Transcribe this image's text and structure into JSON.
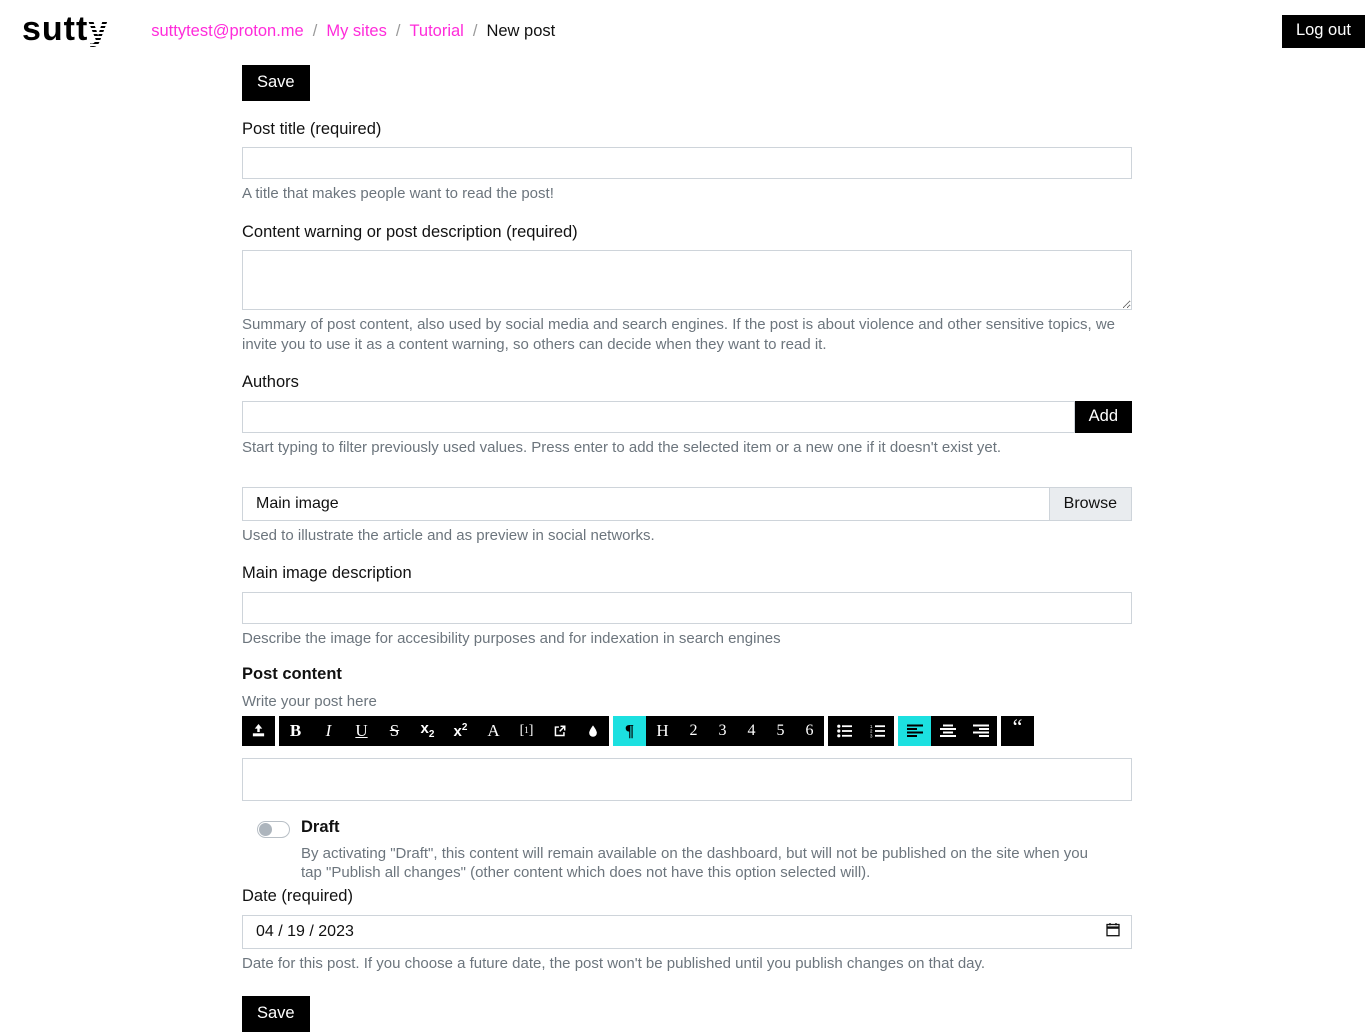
{
  "brand": {
    "name": "sutty",
    "accent": "#1ce0e0",
    "link_color": "#ff2bda"
  },
  "header": {
    "breadcrumb": [
      {
        "label": "suttytest@proton.me",
        "type": "link"
      },
      {
        "label": "/",
        "type": "sep"
      },
      {
        "label": "My sites",
        "type": "link"
      },
      {
        "label": "/",
        "type": "sep"
      },
      {
        "label": "Tutorial",
        "type": "link"
      },
      {
        "label": "/",
        "type": "sep"
      },
      {
        "label": "New post",
        "type": "current"
      }
    ],
    "logout_label": "Log out"
  },
  "form": {
    "save_top_label": "Save",
    "save_bottom_label": "Save",
    "post_title": {
      "label": "Post title (required)",
      "value": "",
      "help": "A title that makes people want to read the post!"
    },
    "content_warning": {
      "label": "Content warning or post description (required)",
      "value": "",
      "help": "Summary of post content, also used by social media and search engines. If the post is about violence and other sensitive topics, we invite you to use it as a content warning, so others can decide when they want to read it."
    },
    "authors": {
      "label": "Authors",
      "value": "",
      "add_label": "Add",
      "help": "Start typing to filter previously used values. Press enter to add the selected item or a new one if it doesn't exist yet."
    },
    "main_image": {
      "filename_label": "Main image",
      "browse_label": "Browse",
      "help": "Used to illustrate the article and as preview in social networks."
    },
    "main_image_description": {
      "label": "Main image description",
      "value": "",
      "help": "Describe the image for accesibility purposes and for indexation in search engines"
    },
    "post_content": {
      "label": "Post content",
      "hint": "Write your post here",
      "value": ""
    },
    "draft": {
      "title": "Draft",
      "state": "off",
      "help": "By activating \"Draft\", this content will remain available on the dashboard, but will not be published on the site when you tap \"Publish all changes\" (other content which does not have this option selected will)."
    },
    "date": {
      "label": "Date (required)",
      "value": "04 / 19 / 2023",
      "help": "Date for this post. If you choose a future date, the post won't be published until you publish changes on that day."
    }
  },
  "toolbar": {
    "groups": [
      {
        "name": "upload",
        "buttons": [
          {
            "icon": "upload-icon",
            "label": "",
            "active": false
          }
        ]
      },
      {
        "name": "inline-format",
        "buttons": [
          {
            "icon": "bold-icon",
            "label": "B",
            "active": false
          },
          {
            "icon": "italic-icon",
            "label": "I",
            "active": false
          },
          {
            "icon": "underline-icon",
            "label": "U",
            "active": false
          },
          {
            "icon": "strikethrough-icon",
            "label": "S",
            "active": false
          },
          {
            "icon": "subscript-icon",
            "label": "x2",
            "active": false
          },
          {
            "icon": "superscript-icon",
            "label": "x2",
            "active": false
          },
          {
            "icon": "font-icon",
            "label": "A",
            "active": false
          },
          {
            "icon": "footnote-icon",
            "label": "[1]",
            "active": false
          },
          {
            "icon": "external-link-icon",
            "label": "",
            "active": false
          },
          {
            "icon": "ink-drop-icon",
            "label": "",
            "active": false
          }
        ]
      },
      {
        "name": "block-format",
        "buttons": [
          {
            "icon": "paragraph-icon",
            "label": "¶",
            "active": true
          },
          {
            "icon": "heading-icon",
            "label": "H",
            "active": false
          },
          {
            "icon": "heading-2-icon",
            "label": "2",
            "active": false
          },
          {
            "icon": "heading-3-icon",
            "label": "3",
            "active": false
          },
          {
            "icon": "heading-4-icon",
            "label": "4",
            "active": false
          },
          {
            "icon": "heading-5-icon",
            "label": "5",
            "active": false
          },
          {
            "icon": "heading-6-icon",
            "label": "6",
            "active": false
          }
        ]
      },
      {
        "name": "lists",
        "buttons": [
          {
            "icon": "unordered-list-icon",
            "label": "",
            "active": false
          },
          {
            "icon": "ordered-list-icon",
            "label": "",
            "active": false
          }
        ]
      },
      {
        "name": "alignment",
        "buttons": [
          {
            "icon": "align-left-icon",
            "label": "",
            "active": true
          },
          {
            "icon": "align-center-icon",
            "label": "",
            "active": false
          },
          {
            "icon": "align-right-icon",
            "label": "",
            "active": false
          }
        ]
      },
      {
        "name": "quote",
        "buttons": [
          {
            "icon": "blockquote-icon",
            "label": "“",
            "active": false
          }
        ]
      }
    ]
  }
}
